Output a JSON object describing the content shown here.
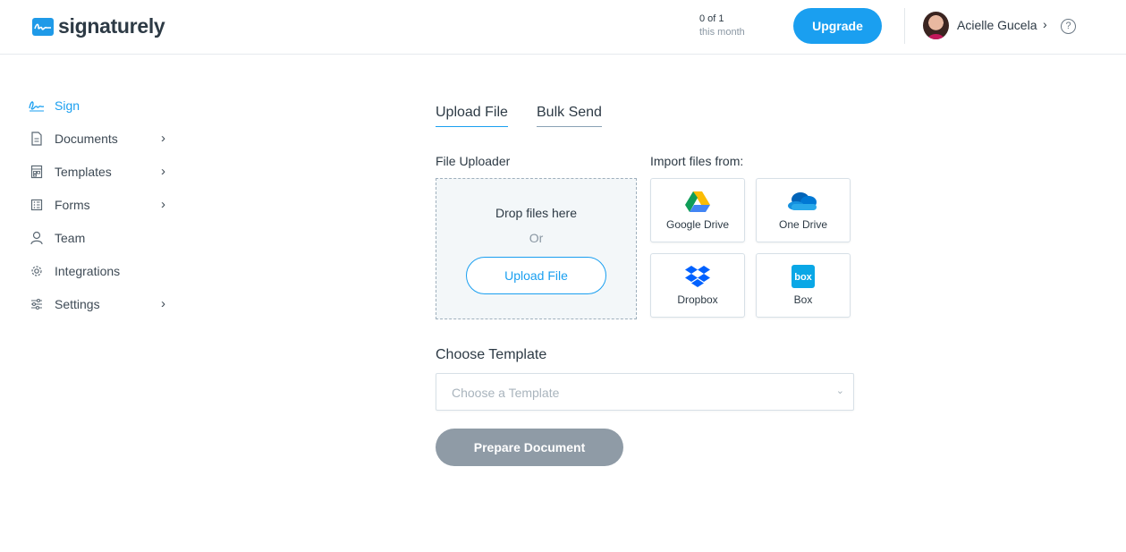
{
  "brand": {
    "name": "signaturely"
  },
  "header": {
    "usage_count": "0 of 1",
    "usage_period": "this month",
    "upgrade_label": "Upgrade",
    "user_name": "Acielle Gucela",
    "help_glyph": "?",
    "accent_color": "#1a9ff0"
  },
  "sidebar": {
    "items": [
      {
        "label": "Sign",
        "icon": "signature-icon",
        "active": true,
        "has_submenu": false
      },
      {
        "label": "Documents",
        "icon": "document-icon",
        "active": false,
        "has_submenu": true
      },
      {
        "label": "Templates",
        "icon": "template-icon",
        "active": false,
        "has_submenu": true
      },
      {
        "label": "Forms",
        "icon": "form-icon",
        "active": false,
        "has_submenu": true
      },
      {
        "label": "Team",
        "icon": "user-icon",
        "active": false,
        "has_submenu": false
      },
      {
        "label": "Integrations",
        "icon": "gear-icon",
        "active": false,
        "has_submenu": false
      },
      {
        "label": "Settings",
        "icon": "sliders-icon",
        "active": false,
        "has_submenu": true
      }
    ]
  },
  "main": {
    "tabs": [
      {
        "label": "Upload File",
        "active": true
      },
      {
        "label": "Bulk Send",
        "active": false
      }
    ],
    "uploader": {
      "label": "File Uploader",
      "drop_text": "Drop files here",
      "or_text": "Or",
      "upload_button": "Upload File"
    },
    "import": {
      "label": "Import files from:",
      "sources": [
        {
          "label": "Google Drive",
          "icon": "google-drive-icon"
        },
        {
          "label": "One Drive",
          "icon": "onedrive-icon"
        },
        {
          "label": "Dropbox",
          "icon": "dropbox-icon"
        },
        {
          "label": "Box",
          "icon": "box-icon"
        }
      ]
    },
    "template": {
      "title": "Choose Template",
      "placeholder": "Choose a Template"
    },
    "prepare_button": "Prepare Document"
  }
}
